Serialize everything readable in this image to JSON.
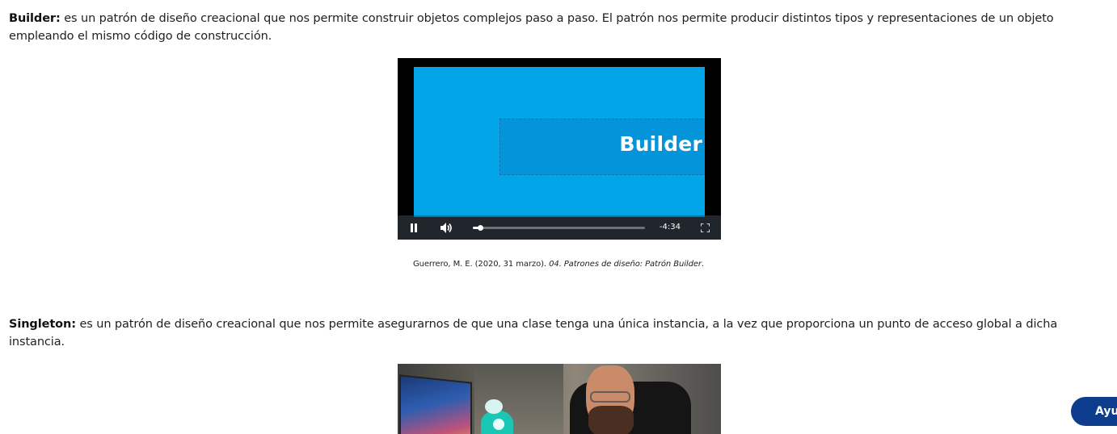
{
  "builder": {
    "term": "Builder:",
    "text": " es un patrón de diseño creacional que nos permite construir objetos complejos paso a paso. El patrón nos permite producir distintos tipos y representaciones de un objeto empleando el mismo código de construcción."
  },
  "video_builder": {
    "title_overlay": "Builder",
    "time_remaining": "-4:34",
    "progress": 0.04,
    "icons": [
      "pause-icon",
      "volume-icon",
      "fullscreen-icon"
    ]
  },
  "caption": {
    "author": "Guerrero, M. E. (2020, 31 marzo). ",
    "work": "04. Patrones de diseño: Patrón Builder",
    "end": "."
  },
  "singleton": {
    "term": "Singleton:",
    "text": " es un patrón de diseño creacional que nos permite asegurarnos de que una clase tenga una única instancia, a la vez que proporciona un punto de acceso global a dicha instancia."
  },
  "help_button": {
    "label": "Ayu"
  },
  "colors": {
    "video_bg": "#02a5e8",
    "help_button_bg": "#0d3d8c"
  }
}
